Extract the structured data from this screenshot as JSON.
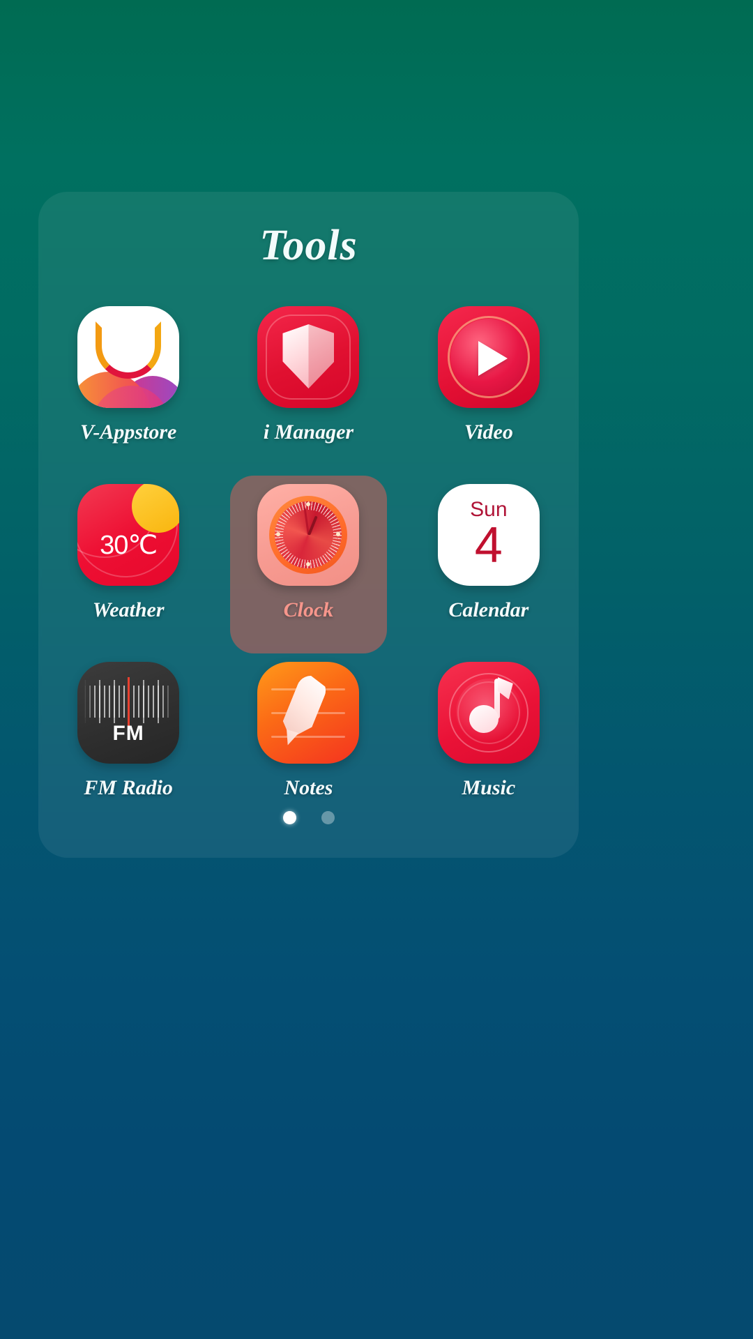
{
  "screen": {
    "background_top_color": "#006b52",
    "background_bottom_color": "#054a6f"
  },
  "folder": {
    "title": "Tools",
    "panel_color": "rgba(255,255,255,0.075)",
    "selected_app_label_color": "#f7968c",
    "selection_highlight_color": "rgba(190,96,88,0.62)",
    "apps": [
      {
        "label": "V-Appstore",
        "icon_name": "v-appstore-icon",
        "selected": false
      },
      {
        "label": "i Manager",
        "icon_name": "i-manager-shield-icon",
        "selected": false
      },
      {
        "label": "Video",
        "icon_name": "video-play-icon",
        "selected": false
      },
      {
        "label": "Weather",
        "icon_name": "weather-icon",
        "selected": false,
        "icon_text": "30℃"
      },
      {
        "label": "Clock",
        "icon_name": "clock-icon",
        "selected": true
      },
      {
        "label": "Calendar",
        "icon_name": "calendar-icon",
        "selected": false,
        "icon_weekday": "Sun",
        "icon_date": "4"
      },
      {
        "label": "FM Radio",
        "icon_name": "fm-radio-icon",
        "selected": false,
        "icon_text": "FM"
      },
      {
        "label": "Notes",
        "icon_name": "notes-quill-icon",
        "selected": false
      },
      {
        "label": "Music",
        "icon_name": "music-note-icon",
        "selected": false
      }
    ],
    "pagination": {
      "total_pages": 2,
      "active_page": 1
    }
  }
}
